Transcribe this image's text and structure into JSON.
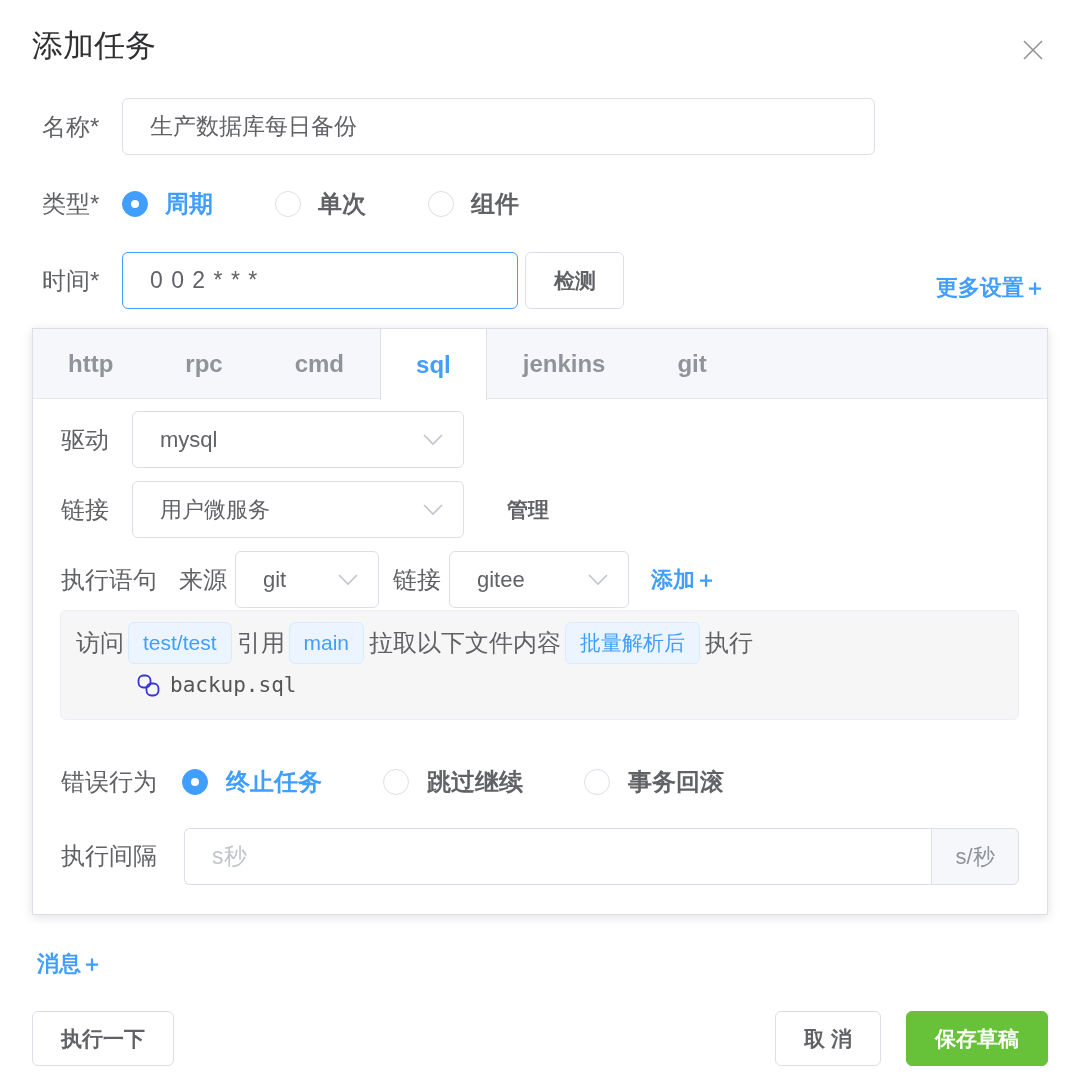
{
  "dialog": {
    "title": "添加任务"
  },
  "form": {
    "name": {
      "label": "名称*",
      "value": "生产数据库每日备份"
    },
    "type": {
      "label": "类型*",
      "options": [
        {
          "label": "周期",
          "selected": true
        },
        {
          "label": "单次",
          "selected": false
        },
        {
          "label": "组件",
          "selected": false
        }
      ]
    },
    "time": {
      "label": "时间*",
      "value": "0 0 2 * * *",
      "focused": true,
      "check_button": "检测"
    },
    "more_settings_link": "更多设置＋"
  },
  "task_tabs": {
    "tabs": [
      {
        "label": "http",
        "selected": false
      },
      {
        "label": "rpc",
        "selected": false
      },
      {
        "label": "cmd",
        "selected": false
      },
      {
        "label": "sql",
        "selected": true
      },
      {
        "label": "jenkins",
        "selected": false
      },
      {
        "label": "git",
        "selected": false
      }
    ],
    "sql": {
      "driver": {
        "label": "驱动",
        "value": "mysql"
      },
      "connection": {
        "label": "链接",
        "value": "用户微服务",
        "manage_link": "管理"
      },
      "statement": {
        "label": "执行语句",
        "source_label": "来源",
        "source_value": "git",
        "repo_label": "链接",
        "repo_value": "gitee",
        "add_link": "添加＋"
      },
      "preview": {
        "parts": [
          {
            "kind": "text",
            "text": "访问"
          },
          {
            "kind": "tag",
            "text": "test/test"
          },
          {
            "kind": "text",
            "text": "引用"
          },
          {
            "kind": "tag",
            "text": "main"
          },
          {
            "kind": "text",
            "text": "拉取以下文件内容"
          },
          {
            "kind": "tag",
            "text": "批量解析后"
          },
          {
            "kind": "text",
            "text": "执行"
          }
        ],
        "files": [
          "backup.sql"
        ]
      },
      "error_behavior": {
        "label": "错误行为",
        "options": [
          {
            "label": "终止任务",
            "selected": true
          },
          {
            "label": "跳过继续",
            "selected": false
          },
          {
            "label": "事务回滚",
            "selected": false
          }
        ]
      },
      "interval": {
        "label": "执行间隔",
        "placeholder": "s秒",
        "unit": "s/秒"
      }
    }
  },
  "message_link": "消息＋",
  "footer": {
    "left_buttons": [
      {
        "label": "执行一下",
        "kind": "default"
      }
    ],
    "right_buttons": [
      {
        "label": "取 消",
        "kind": "default"
      },
      {
        "label": "保存草稿",
        "kind": "success"
      }
    ]
  }
}
